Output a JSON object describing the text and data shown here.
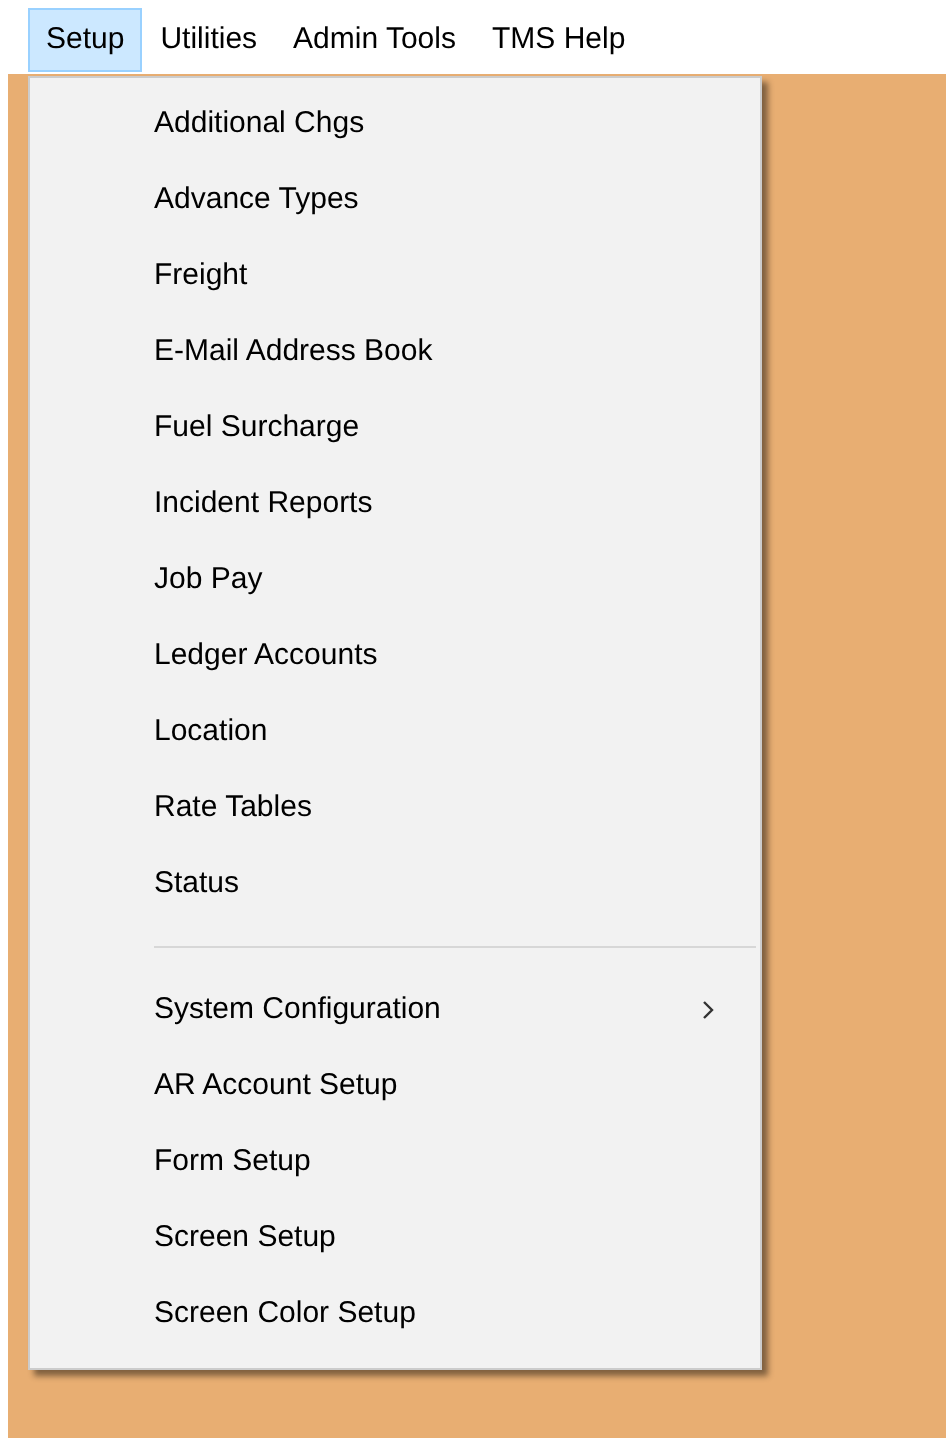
{
  "menu_bar": [
    {
      "label": "Setup",
      "selected": true
    },
    {
      "label": "Utilities",
      "selected": false
    },
    {
      "label": "Admin Tools",
      "selected": false
    },
    {
      "label": "TMS Help",
      "selected": false
    }
  ],
  "dropdown": {
    "items": [
      {
        "kind": "item",
        "label": "Additional Chgs"
      },
      {
        "kind": "item",
        "label": "Advance Types"
      },
      {
        "kind": "item",
        "label": "Freight"
      },
      {
        "kind": "item",
        "label": "E-Mail Address Book"
      },
      {
        "kind": "item",
        "label": "Fuel Surcharge"
      },
      {
        "kind": "item",
        "label": "Incident Reports"
      },
      {
        "kind": "item",
        "label": "Job Pay"
      },
      {
        "kind": "item",
        "label": "Ledger Accounts"
      },
      {
        "kind": "item",
        "label": "Location"
      },
      {
        "kind": "item",
        "label": "Rate Tables"
      },
      {
        "kind": "item",
        "label": "Status"
      },
      {
        "kind": "separator"
      },
      {
        "kind": "submenu",
        "label": "System Configuration"
      },
      {
        "kind": "item",
        "label": "AR Account Setup"
      },
      {
        "kind": "item",
        "label": "Form Setup"
      },
      {
        "kind": "item",
        "label": "Screen Setup"
      },
      {
        "kind": "item",
        "label": "Screen Color Setup"
      }
    ]
  }
}
